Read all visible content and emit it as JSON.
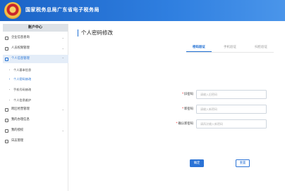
{
  "header": {
    "site_title": "国家税务总局广东省电子税务局"
  },
  "sidebar": {
    "heading": "账户中心",
    "items": [
      {
        "label": "企业信息查询",
        "icon": "building-icon",
        "has_children": true
      },
      {
        "label": "人员权限管理",
        "icon": "user-icon",
        "has_children": true
      },
      {
        "label": "个人信息管理",
        "icon": "profile-icon",
        "has_children": true,
        "active": true
      },
      {
        "label": "跨区经营管理",
        "icon": "document-icon",
        "has_children": true
      },
      {
        "label": "我的办理信息",
        "icon": "document-icon",
        "has_children": false
      },
      {
        "label": "我的授权",
        "icon": "key-icon",
        "has_children": true
      },
      {
        "label": "日志管理",
        "icon": "list-icon",
        "has_children": false
      }
    ],
    "submenu": [
      {
        "label": "个人基本信息",
        "active": false
      },
      {
        "label": "个人密码修改",
        "active": true
      },
      {
        "label": "手机号码修改",
        "active": false
      },
      {
        "label": "个人信息维护",
        "active": false
      }
    ]
  },
  "main": {
    "title": "个人密码修改",
    "tabs": [
      {
        "label": "密码验证",
        "active": true
      },
      {
        "label": "手机验证",
        "active": false
      },
      {
        "label": "扫脸验证",
        "active": false
      }
    ],
    "form": {
      "old_password": {
        "label": "旧密码",
        "placeholder": "请输入旧密码",
        "value": ""
      },
      "new_password": {
        "label": "新密码",
        "placeholder": "请输入新密码",
        "value": ""
      },
      "confirm_password": {
        "label": "确认新密码",
        "placeholder": "请再次输入新密码",
        "value": ""
      }
    },
    "buttons": {
      "confirm": "确定",
      "reset": "重置"
    }
  },
  "colors": {
    "header": "#1b63c6",
    "accent": "#1f6fd3",
    "sidebar_heading_bg": "#dde1e6",
    "active_menu_bg": "#e4edf8"
  }
}
